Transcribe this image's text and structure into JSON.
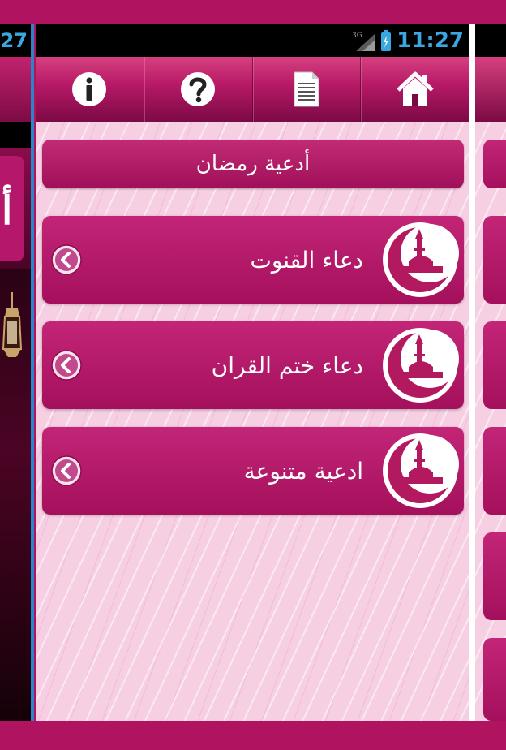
{
  "status_bar": {
    "time": "11:27",
    "network_label": "3G"
  },
  "left_screen": {
    "time_fragment": "27",
    "banner_glyph": "أ"
  },
  "toolbar": {
    "buttons": [
      {
        "icon": "info-icon"
      },
      {
        "icon": "help-icon"
      },
      {
        "icon": "document-icon"
      },
      {
        "icon": "home-icon"
      }
    ]
  },
  "header": {
    "title": "أدعية رمضان"
  },
  "list": {
    "items": [
      {
        "label": "دعاء القنوت",
        "icon": "mosque-moon-icon"
      },
      {
        "label": "دعاء ختم القران",
        "icon": "mosque-moon-icon"
      },
      {
        "label": "ادعية متنوعة",
        "icon": "mosque-moon-icon"
      }
    ]
  },
  "colors": {
    "accent": "#b0135f",
    "background": "#f6cfe3",
    "status_time": "#3aa7e0"
  }
}
